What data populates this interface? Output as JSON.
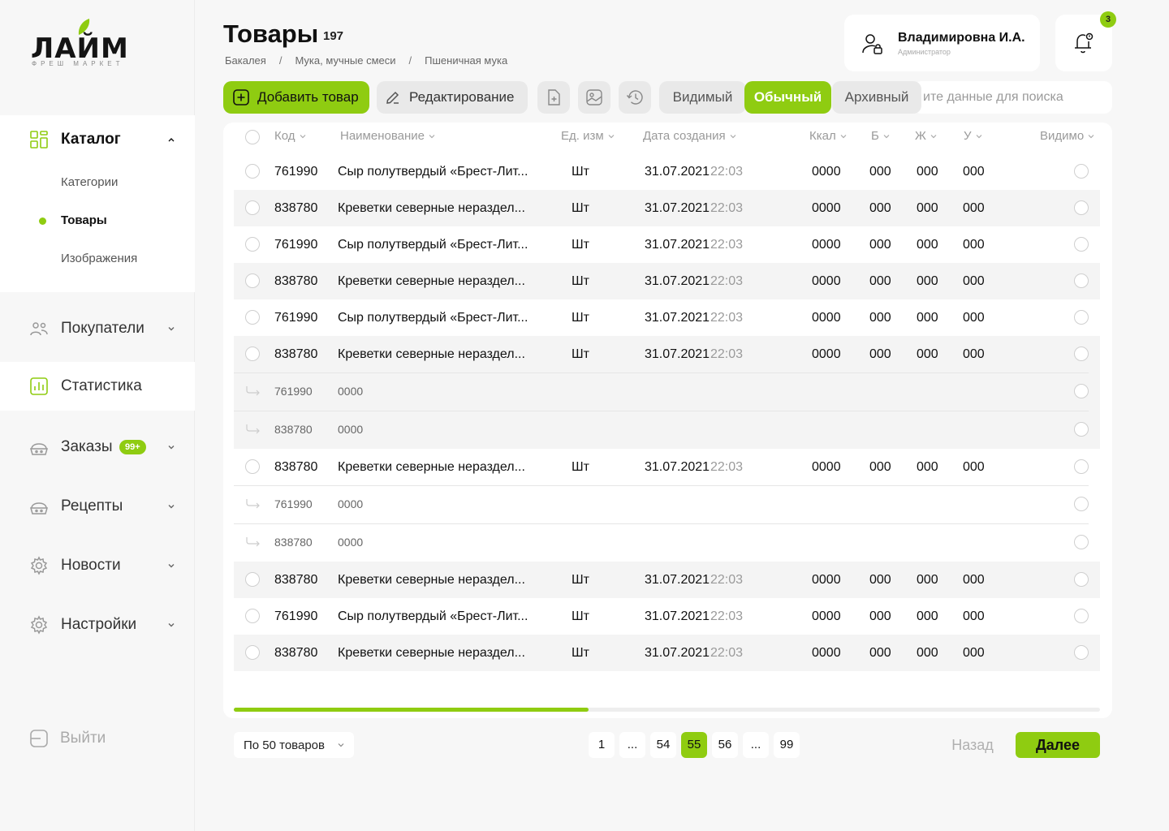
{
  "brand": {
    "name": "ЛАЙМ",
    "subtitle": "ФРЕШ МАРКЕТ"
  },
  "sidebar": {
    "catalog": {
      "label": "Каталог",
      "sub": [
        {
          "label": "Категории"
        },
        {
          "label": "Товары",
          "active": true
        },
        {
          "label": "Изображения"
        }
      ]
    },
    "items": [
      {
        "label": "Покупатели"
      },
      {
        "label": "Статистика"
      },
      {
        "label": "Заказы",
        "badge": "99+"
      },
      {
        "label": "Рецепты"
      },
      {
        "label": "Новости"
      },
      {
        "label": "Настройки"
      }
    ],
    "logout": "Выйти"
  },
  "header": {
    "title": "Товары",
    "count": "197",
    "breadcrumbs": [
      "Бакалея",
      "Мука, мучные смеси",
      "Пшеничная мука"
    ],
    "breadcrumb_sep": "/"
  },
  "user": {
    "name": "Владимировна И.А.",
    "role": "Администратор",
    "notifications": "3"
  },
  "toolbar": {
    "add_label": "Добавить товар",
    "edit_label": "Редактирование",
    "segments": [
      {
        "label": "Видимый",
        "active": false
      },
      {
        "label": "Обычный",
        "active": true
      },
      {
        "label": "Архивный",
        "active": false
      }
    ],
    "search_placeholder": "ите данные для поиска"
  },
  "table": {
    "columns": [
      "Код",
      "Наименование",
      "Ед. изм",
      "Дата создания",
      "Ккал",
      "Б",
      "Ж",
      "У",
      "Видимо"
    ],
    "rows": [
      {
        "type": "main",
        "code": "761990",
        "name": "Сыр полутвердый «Брест-Лит...",
        "unit": "Шт",
        "date": "31.07.2021",
        "time": "22:03",
        "kcal": "0000",
        "b": "000",
        "zh": "000",
        "u": "000"
      },
      {
        "type": "main",
        "code": "838780",
        "name": "Креветки северные нераздел...",
        "unit": "Шт",
        "date": "31.07.2021",
        "time": "22:03",
        "kcal": "0000",
        "b": "000",
        "zh": "000",
        "u": "000"
      },
      {
        "type": "main",
        "code": "761990",
        "name": "Сыр полутвердый «Брест-Лит...",
        "unit": "Шт",
        "date": "31.07.2021",
        "time": "22:03",
        "kcal": "0000",
        "b": "000",
        "zh": "000",
        "u": "000"
      },
      {
        "type": "main",
        "code": "838780",
        "name": "Креветки северные нераздел...",
        "unit": "Шт",
        "date": "31.07.2021",
        "time": "22:03",
        "kcal": "0000",
        "b": "000",
        "zh": "000",
        "u": "000"
      },
      {
        "type": "main",
        "code": "761990",
        "name": "Сыр полутвердый «Брест-Лит...",
        "unit": "Шт",
        "date": "31.07.2021",
        "time": "22:03",
        "kcal": "0000",
        "b": "000",
        "zh": "000",
        "u": "000"
      },
      {
        "type": "main",
        "code": "838780",
        "name": "Креветки северные нераздел...",
        "unit": "Шт",
        "date": "31.07.2021",
        "time": "22:03",
        "kcal": "0000",
        "b": "000",
        "zh": "000",
        "u": "000"
      },
      {
        "type": "sub",
        "code": "761990",
        "value": "0000"
      },
      {
        "type": "sub",
        "code": "838780",
        "value": "0000"
      },
      {
        "type": "main",
        "code": "838780",
        "name": "Креветки северные нераздел...",
        "unit": "Шт",
        "date": "31.07.2021",
        "time": "22:03",
        "kcal": "0000",
        "b": "000",
        "zh": "000",
        "u": "000"
      },
      {
        "type": "sub",
        "code": "761990",
        "value": "0000"
      },
      {
        "type": "sub",
        "code": "838780",
        "value": "0000"
      },
      {
        "type": "main",
        "code": "838780",
        "name": "Креветки северные нераздел...",
        "unit": "Шт",
        "date": "31.07.2021",
        "time": "22:03",
        "kcal": "0000",
        "b": "000",
        "zh": "000",
        "u": "000"
      },
      {
        "type": "main",
        "code": "761990",
        "name": "Сыр полутвердый «Брест-Лит...",
        "unit": "Шт",
        "date": "31.07.2021",
        "time": "22:03",
        "kcal": "0000",
        "b": "000",
        "zh": "000",
        "u": "000"
      },
      {
        "type": "main",
        "code": "838780",
        "name": "Креветки северные нераздел...",
        "unit": "Шт",
        "date": "31.07.2021",
        "time": "22:03",
        "kcal": "0000",
        "b": "000",
        "zh": "000",
        "u": "000"
      }
    ],
    "horizontal_scroll_fraction": 0.41
  },
  "pagination": {
    "per_page_label": "По 50 товаров",
    "pages": [
      {
        "label": "1",
        "active": false
      },
      {
        "label": "...",
        "active": false
      },
      {
        "label": "54",
        "active": false
      },
      {
        "label": "55",
        "active": true
      },
      {
        "label": "56",
        "active": false
      },
      {
        "label": "...",
        "active": false
      },
      {
        "label": "99",
        "active": false
      }
    ],
    "back_label": "Назад",
    "next_label": "Далее"
  },
  "colors": {
    "accent": "#8fcc11"
  }
}
